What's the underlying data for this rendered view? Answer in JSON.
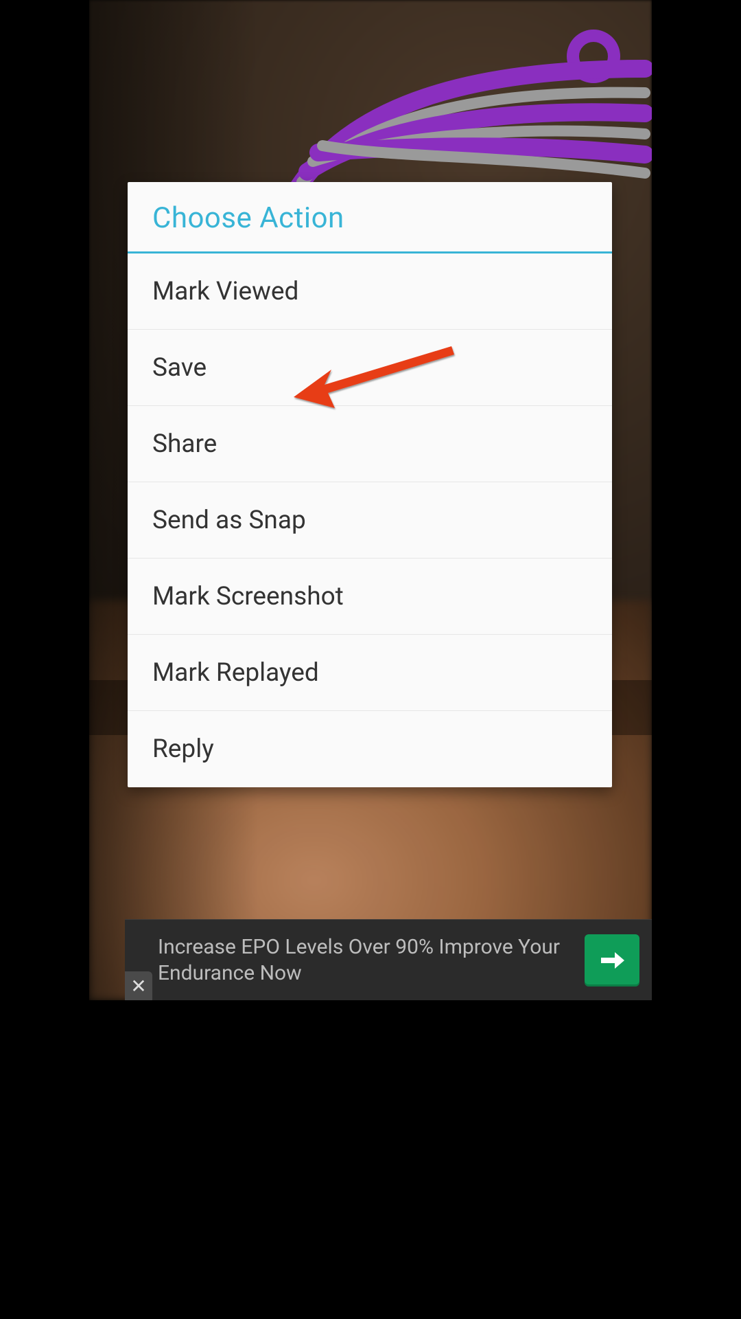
{
  "dialog": {
    "title": "Choose Action",
    "items": [
      {
        "label": "Mark Viewed"
      },
      {
        "label": "Save"
      },
      {
        "label": "Share"
      },
      {
        "label": "Send as Snap"
      },
      {
        "label": "Mark Screenshot"
      },
      {
        "label": "Mark Replayed"
      },
      {
        "label": "Reply"
      }
    ]
  },
  "annotation": {
    "points_to": "Save"
  },
  "ad": {
    "text": "Increase EPO Levels Over 90% Improve Your Endurance Now",
    "close_glyph": "✕",
    "cta_icon": "arrow-right"
  },
  "colors": {
    "accent": "#38b4d6",
    "arrow": "#e73c17",
    "ad_cta": "#0f9d58",
    "scribble_purple": "#8a2fbf",
    "scribble_gray": "#9a9a9a"
  }
}
